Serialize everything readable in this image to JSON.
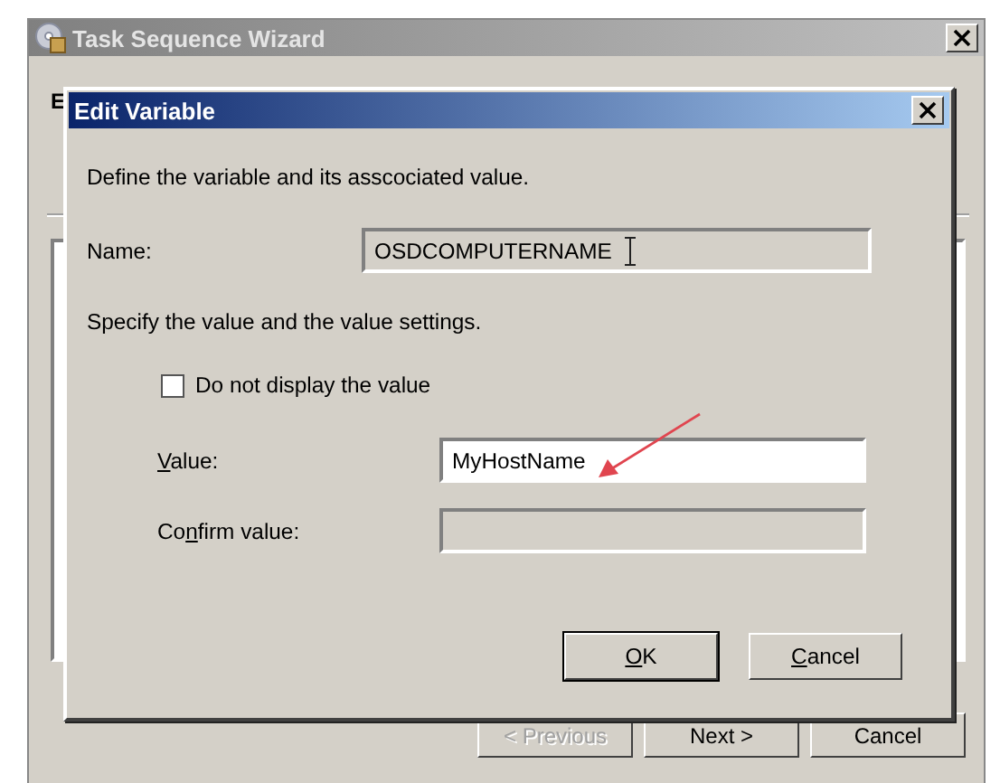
{
  "wizard": {
    "title": "Task Sequence Wizard",
    "heading": "E",
    "buttons": [
      {
        "label": "< Previous",
        "disabled": true
      },
      {
        "label": "Next >",
        "disabled": false
      },
      {
        "label": "Cancel",
        "disabled": false
      }
    ]
  },
  "dialog": {
    "title": "Edit Variable",
    "intro": "Define the variable and its asscociated value.",
    "name": {
      "label": "Name:",
      "value": "OSDCOMPUTERNAME",
      "disabled": true
    },
    "settings_text": "Specify the value and the value settings.",
    "hide_value": {
      "label": "Do not display the value",
      "checked": false
    },
    "value": {
      "label": "Value:",
      "value": "MyHostName",
      "disabled": false
    },
    "confirm": {
      "label": "Confirm value:",
      "disabled": true
    },
    "buttons": [
      {
        "label": "OK",
        "default": true
      },
      {
        "label": "Cancel",
        "default": false
      }
    ]
  }
}
